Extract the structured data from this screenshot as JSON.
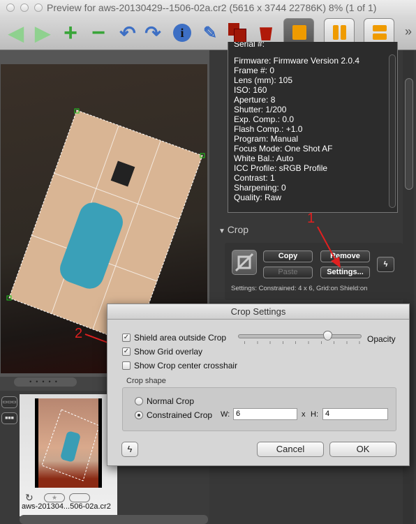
{
  "window": {
    "title": "Preview for aws-20130429--1506-02a.cr2 (5616 x 3744 22786K) 8% (1 of 1)"
  },
  "toolbar": {
    "icons": [
      "arrow-left-icon",
      "arrow-right-icon",
      "zoom-in-icon",
      "zoom-out-icon",
      "rotate-left-icon",
      "rotate-right-icon",
      "info-icon",
      "brush-icon",
      "copy-icon",
      "trash-icon",
      "single-view-icon",
      "dual-view-icon",
      "split-view-icon",
      "overflow-icon"
    ],
    "overflow": "»"
  },
  "metadata": {
    "lines": [
      "Serial #:",
      "Firmware: Firmware Version 2.0.4",
      "Frame #: 0",
      "Lens (mm): 105",
      "ISO: 160",
      "Aperture: 8",
      "Shutter: 1/200",
      "Exp. Comp.: 0.0",
      "Flash Comp.: +1.0",
      "Program: Manual",
      "Focus Mode: One Shot AF",
      "White Bal.: Auto",
      "ICC Profile: sRGB Profile",
      "Contrast: 1",
      "Sharpening: 0",
      "Quality: Raw"
    ]
  },
  "crop": {
    "header": "Crop",
    "copy": "Copy",
    "paste": "Paste",
    "remove": "Remove",
    "settings": "Settings...",
    "summary": "Settings:   Constrained: 4 x 6, Grid:on Shield:on"
  },
  "annotations": {
    "one": "1",
    "two": "2",
    "color": "#e02020"
  },
  "thumbnail": {
    "filename": "aws-201304...506-02a.cr2"
  },
  "dialog": {
    "title": "Crop Settings",
    "shield": {
      "label": "Shield area outside Crop",
      "checked": true
    },
    "grid": {
      "label": "Show Grid overlay",
      "checked": true
    },
    "crosshair": {
      "label": "Show Crop center crosshair",
      "checked": false
    },
    "opacity_label": "Opacity",
    "opacity_value": 0.75,
    "crop_shape_label": "Crop shape",
    "normal_crop": "Normal Crop",
    "constrained_crop": "Constrained Crop",
    "selected_shape": "Constrained Crop",
    "w_label": "W:",
    "w_value": "6",
    "x_label": "x",
    "h_label": "H:",
    "h_value": "4",
    "cancel": "Cancel",
    "ok": "OK"
  }
}
